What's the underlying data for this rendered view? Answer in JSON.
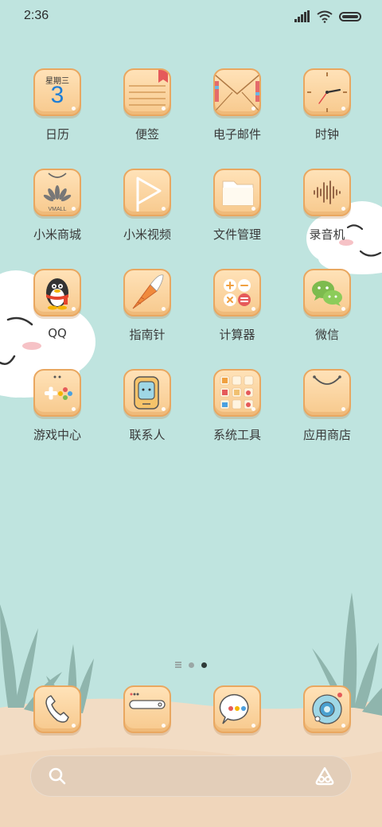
{
  "status_bar": {
    "time": "2:36",
    "battery_level": 1.0
  },
  "apps": [
    {
      "id": "calendar",
      "label": "日历",
      "weekday": "星期三",
      "day": "3"
    },
    {
      "id": "notes",
      "label": "便签"
    },
    {
      "id": "email",
      "label": "电子邮件"
    },
    {
      "id": "clock",
      "label": "时钟"
    },
    {
      "id": "mall",
      "label": "小米商城",
      "brand_text": "VMALL"
    },
    {
      "id": "video",
      "label": "小米视频"
    },
    {
      "id": "files",
      "label": "文件管理"
    },
    {
      "id": "recorder",
      "label": "录音机"
    },
    {
      "id": "qq",
      "label": "QQ"
    },
    {
      "id": "compass",
      "label": "指南针"
    },
    {
      "id": "calculator",
      "label": "计算器"
    },
    {
      "id": "wechat",
      "label": "微信"
    },
    {
      "id": "games",
      "label": "游戏中心"
    },
    {
      "id": "contacts",
      "label": "联系人"
    },
    {
      "id": "tools",
      "label": "系统工具"
    },
    {
      "id": "appstore",
      "label": "应用商店"
    }
  ],
  "page_indicator": {
    "page_count": 2,
    "current_page": 2
  },
  "dock": [
    {
      "id": "phone",
      "icon": "phone-icon"
    },
    {
      "id": "browser",
      "icon": "browser-icon"
    },
    {
      "id": "messages",
      "icon": "messages-icon"
    },
    {
      "id": "camera",
      "icon": "camera-icon"
    }
  ],
  "colors": {
    "background": "#bfe4df",
    "tile": "#f7c98d",
    "tile_border": "#e9a760",
    "calendar_day": "#1e7ed6"
  }
}
